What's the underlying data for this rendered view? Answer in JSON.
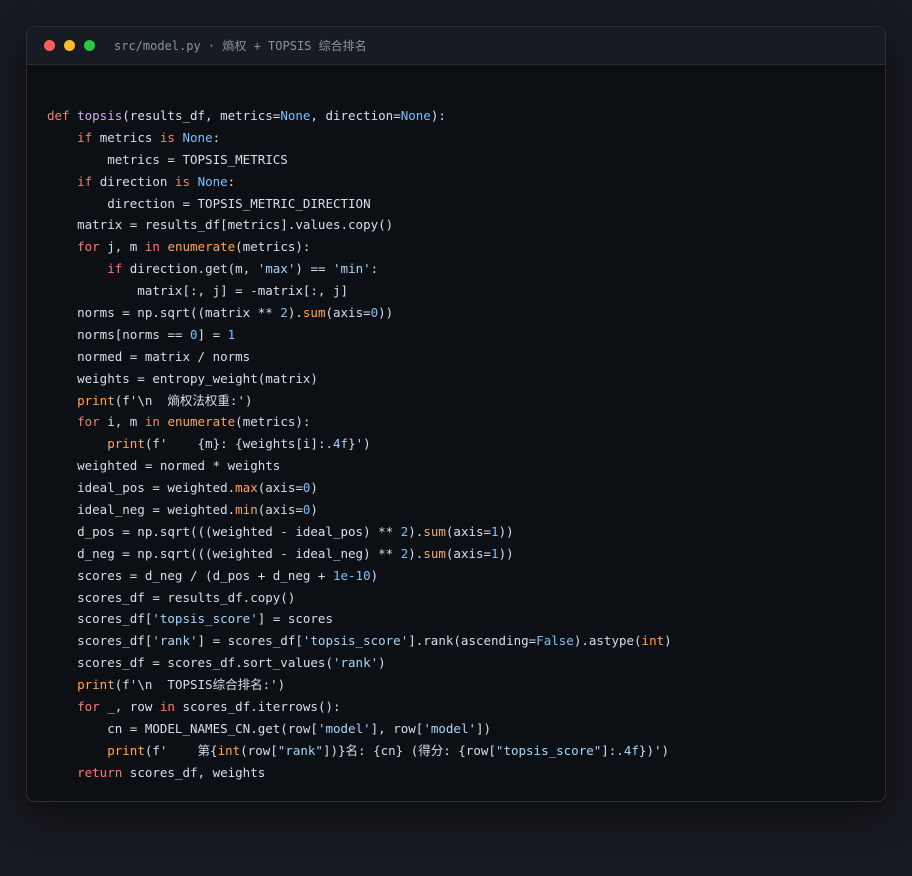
{
  "window": {
    "title": "src/model.py · 熵权 + TOPSIS 综合排名",
    "controls": {
      "close_color": "#ff5f57",
      "minimize_color": "#febc2e",
      "maximize_color": "#28c840"
    }
  },
  "code_lines": [
    [
      [
        "kw",
        "def "
      ],
      [
        "fn",
        "topsis"
      ],
      [
        "plain",
        "(results_df, metrics="
      ],
      [
        "const",
        "None"
      ],
      [
        "plain",
        ", direction="
      ],
      [
        "const",
        "None"
      ],
      [
        "plain",
        "):"
      ]
    ],
    [
      [
        "plain",
        "    "
      ],
      [
        "kw",
        "if"
      ],
      [
        "plain",
        " metrics "
      ],
      [
        "kw",
        "is"
      ],
      [
        "plain",
        " "
      ],
      [
        "const",
        "None"
      ],
      [
        "plain",
        ":"
      ]
    ],
    [
      [
        "plain",
        "        metrics = TOPSIS_METRICS"
      ]
    ],
    [
      [
        "plain",
        "    "
      ],
      [
        "kw",
        "if"
      ],
      [
        "plain",
        " direction "
      ],
      [
        "kw",
        "is"
      ],
      [
        "plain",
        " "
      ],
      [
        "const",
        "None"
      ],
      [
        "plain",
        ":"
      ]
    ],
    [
      [
        "plain",
        "        direction = TOPSIS_METRIC_DIRECTION"
      ]
    ],
    [
      [
        "plain",
        "    matrix = results_df[metrics].values.copy()"
      ]
    ],
    [
      [
        "plain",
        "    "
      ],
      [
        "kw",
        "for"
      ],
      [
        "plain",
        " j, m "
      ],
      [
        "kw",
        "in"
      ],
      [
        "plain",
        " "
      ],
      [
        "builtin",
        "enumerate"
      ],
      [
        "plain",
        "(metrics):"
      ]
    ],
    [
      [
        "plain",
        "        "
      ],
      [
        "kw",
        "if"
      ],
      [
        "plain",
        " direction.get(m, "
      ],
      [
        "str",
        "'max'"
      ],
      [
        "plain",
        ") == "
      ],
      [
        "str",
        "'min'"
      ],
      [
        "plain",
        ":"
      ]
    ],
    [
      [
        "plain",
        "            matrix[:, j] = -matrix[:, j]"
      ]
    ],
    [
      [
        "plain",
        "    norms = np.sqrt((matrix ** "
      ],
      [
        "num",
        "2"
      ],
      [
        "plain",
        ")."
      ],
      [
        "builtin",
        "sum"
      ],
      [
        "plain",
        "(axis="
      ],
      [
        "num",
        "0"
      ],
      [
        "plain",
        "))"
      ]
    ],
    [
      [
        "plain",
        "    norms[norms == "
      ],
      [
        "num",
        "0"
      ],
      [
        "plain",
        "] = "
      ],
      [
        "num",
        "1"
      ]
    ],
    [
      [
        "plain",
        "    normed = matrix / norms"
      ]
    ],
    [
      [
        "plain",
        "    weights = entropy_weight(matrix)"
      ]
    ],
    [
      [
        "plain",
        "    "
      ],
      [
        "builtin",
        "print"
      ],
      [
        "plain",
        "(f'\\n  熵权法权重:')"
      ]
    ],
    [
      [
        "plain",
        "    "
      ],
      [
        "kw",
        "for"
      ],
      [
        "plain",
        " i, m "
      ],
      [
        "kw",
        "in"
      ],
      [
        "plain",
        " "
      ],
      [
        "builtin",
        "enumerate"
      ],
      [
        "plain",
        "(metrics):"
      ]
    ],
    [
      [
        "plain",
        "        "
      ],
      [
        "builtin",
        "print"
      ],
      [
        "plain",
        "(f'    {m}: {weights[i]:"
      ],
      [
        "str",
        ".4f"
      ],
      [
        "plain",
        "}')"
      ]
    ],
    [
      [
        "plain",
        "    weighted = normed * weights"
      ]
    ],
    [
      [
        "plain",
        "    ideal_pos = weighted."
      ],
      [
        "builtin",
        "max"
      ],
      [
        "plain",
        "(axis="
      ],
      [
        "num",
        "0"
      ],
      [
        "plain",
        ")"
      ]
    ],
    [
      [
        "plain",
        "    ideal_neg = weighted."
      ],
      [
        "builtin",
        "min"
      ],
      [
        "plain",
        "(axis="
      ],
      [
        "num",
        "0"
      ],
      [
        "plain",
        ")"
      ]
    ],
    [
      [
        "plain",
        "    d_pos = np.sqrt(((weighted - ideal_pos) ** "
      ],
      [
        "num",
        "2"
      ],
      [
        "plain",
        ")."
      ],
      [
        "builtin",
        "sum"
      ],
      [
        "plain",
        "(axis="
      ],
      [
        "num",
        "1"
      ],
      [
        "plain",
        "))"
      ]
    ],
    [
      [
        "plain",
        "    d_neg = np.sqrt(((weighted - ideal_neg) ** "
      ],
      [
        "num",
        "2"
      ],
      [
        "plain",
        ")."
      ],
      [
        "builtin",
        "sum"
      ],
      [
        "plain",
        "(axis="
      ],
      [
        "num",
        "1"
      ],
      [
        "plain",
        "))"
      ]
    ],
    [
      [
        "plain",
        "    scores = d_neg / (d_pos + d_neg + "
      ],
      [
        "num",
        "1e-10"
      ],
      [
        "plain",
        ")"
      ]
    ],
    [
      [
        "plain",
        "    scores_df = results_df.copy()"
      ]
    ],
    [
      [
        "plain",
        "    scores_df["
      ],
      [
        "str",
        "'topsis_score'"
      ],
      [
        "plain",
        "] = scores"
      ]
    ],
    [
      [
        "plain",
        "    scores_df["
      ],
      [
        "str",
        "'rank'"
      ],
      [
        "plain",
        "] = scores_df["
      ],
      [
        "str",
        "'topsis_score'"
      ],
      [
        "plain",
        "].rank(ascending="
      ],
      [
        "const",
        "False"
      ],
      [
        "plain",
        ").astype("
      ],
      [
        "builtin",
        "int"
      ],
      [
        "plain",
        ")"
      ]
    ],
    [
      [
        "plain",
        "    scores_df = scores_df.sort_values("
      ],
      [
        "str",
        "'rank'"
      ],
      [
        "plain",
        ")"
      ]
    ],
    [
      [
        "plain",
        "    "
      ],
      [
        "builtin",
        "print"
      ],
      [
        "plain",
        "(f'\\n  TOPSIS综合排名:')"
      ]
    ],
    [
      [
        "plain",
        "    "
      ],
      [
        "kw",
        "for"
      ],
      [
        "plain",
        " _, row "
      ],
      [
        "kw",
        "in"
      ],
      [
        "plain",
        " scores_df.iterrows():"
      ]
    ],
    [
      [
        "plain",
        "        cn = MODEL_NAMES_CN.get(row["
      ],
      [
        "str",
        "'model'"
      ],
      [
        "plain",
        "], row["
      ],
      [
        "str",
        "'model'"
      ],
      [
        "plain",
        "])"
      ]
    ],
    [
      [
        "plain",
        "        "
      ],
      [
        "builtin",
        "print"
      ],
      [
        "plain",
        "(f'    第{"
      ],
      [
        "builtin",
        "int"
      ],
      [
        "plain",
        "(row["
      ],
      [
        "str",
        "\"rank\""
      ],
      [
        "plain",
        "])}名: {cn} (得分: {row["
      ],
      [
        "str",
        "\"topsis_score\""
      ],
      [
        "plain",
        "]:"
      ],
      [
        "str",
        ".4f"
      ],
      [
        "plain",
        "})')"
      ]
    ],
    [
      [
        "plain",
        "    "
      ],
      [
        "kw",
        "return"
      ],
      [
        "plain",
        " scores_df, weights"
      ]
    ]
  ]
}
